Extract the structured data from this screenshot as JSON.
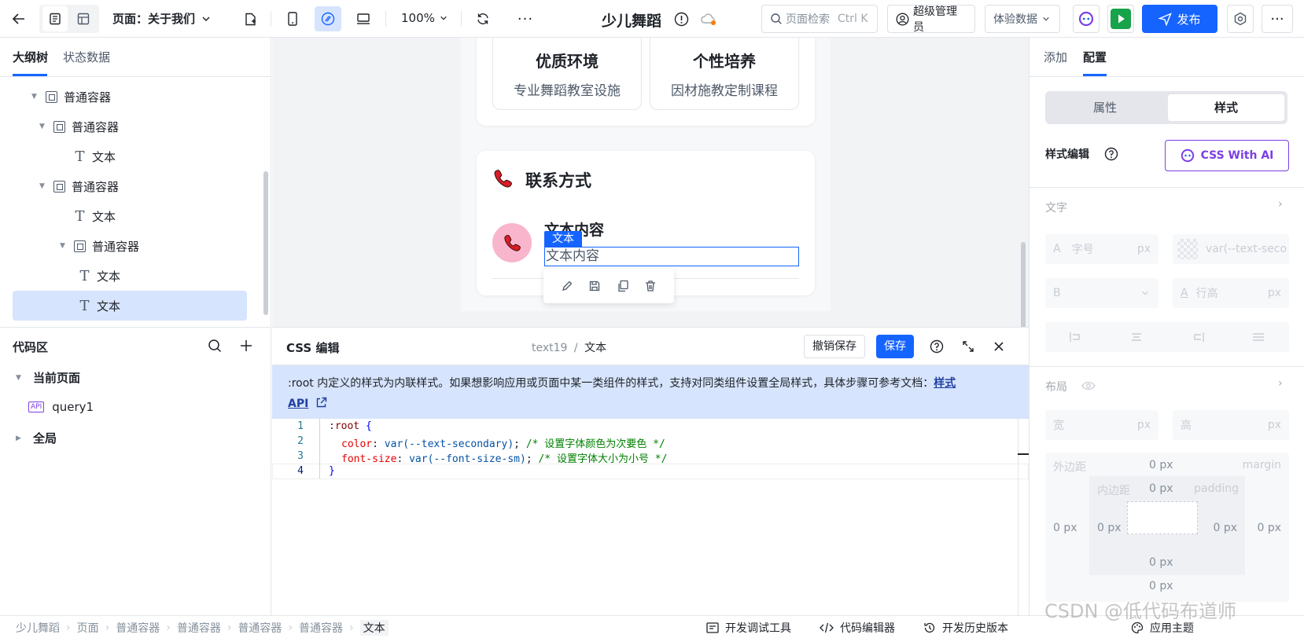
{
  "topbar": {
    "page_label": "页面：关于我们",
    "zoom": "100%",
    "app_title": "少儿舞蹈",
    "search_placeholder": "页面检索",
    "search_shortcut": "Ctrl K",
    "user_role": "超级管理员",
    "data_mode": "体验数据",
    "publish_label": "发布"
  },
  "left": {
    "tabs": [
      "大纲树",
      "状态数据"
    ],
    "tree": [
      {
        "label": "普通容器",
        "type": "container",
        "depth": 0
      },
      {
        "label": "普通容器",
        "type": "container",
        "depth": 1
      },
      {
        "label": "文本",
        "type": "text",
        "depth": 2
      },
      {
        "label": "普通容器",
        "type": "container",
        "depth": 1
      },
      {
        "label": "文本",
        "type": "text",
        "depth": 2
      },
      {
        "label": "普通容器",
        "type": "container",
        "depth": 2
      },
      {
        "label": "文本",
        "type": "text",
        "depth": 3
      },
      {
        "label": "文本",
        "type": "text",
        "depth": 3,
        "selected": true
      }
    ],
    "code_area": {
      "title": "代码区",
      "current_page": "当前页面",
      "query": "query1",
      "query_badge": "API",
      "global": "全局"
    }
  },
  "canvas": {
    "features": [
      {
        "title": "优质环境",
        "subtitle": "专业舞蹈教室设施"
      },
      {
        "title": "个性培养",
        "subtitle": "因材施教定制课程"
      }
    ],
    "contact_title": "联系方式",
    "contact_heading": "文本内容",
    "selection_tag": "文本",
    "selected_text": "文本内容"
  },
  "code": {
    "title": "CSS 编辑",
    "path_id": "text19",
    "path_sep": "/",
    "path_name": "文本",
    "revert_label": "撤销保存",
    "save_label": "保存",
    "notice_text": ":root 内定义的样式为内联样式。如果想影响应用或页面中某一类组件的样式，支持对同类组件设置全局样式，具体步骤可参考文档：",
    "notice_link": "样式",
    "notice_link2": "API",
    "lines": [
      {
        "n": "1",
        "sel": ":root",
        "brace": " {"
      },
      {
        "n": "2",
        "prop": "color",
        "val": "var(--text-secondary)",
        "comment": "/* 设置字体颜色为次要色 */"
      },
      {
        "n": "3",
        "prop": "font-size",
        "val": "var(--font-size-sm)",
        "comment": "/* 设置字体大小为小号 */"
      },
      {
        "n": "4",
        "brace": "}"
      }
    ]
  },
  "right": {
    "tabs": [
      "添加",
      "配置"
    ],
    "segments": [
      "属性",
      "样式"
    ],
    "style_edit": "样式编辑",
    "ai_button": "CSS With AI",
    "text_section": "文字",
    "font_size_ph": "字号",
    "unit_px": "px",
    "color_value": "var(--text-seco",
    "line_height_ph": "行高",
    "layout_section": "布局",
    "width_ph": "宽",
    "height_ph": "高",
    "margin_label": "外边距",
    "margin_en": "margin",
    "padding_label": "内边距",
    "padding_en": "padding",
    "zero_px": "0 px",
    "letter_a": "A",
    "letter_b": "B"
  },
  "bottom": {
    "breadcrumb": [
      "少儿舞蹈",
      "页面",
      "普通容器",
      "普通容器",
      "普通容器",
      "普通容器",
      "文本"
    ],
    "dev_tools": "开发调试工具",
    "code_editor": "代码编辑器",
    "history": "开发历史版本",
    "theme": "应用主题",
    "watermark": "CSDN @低代码布道师"
  },
  "colors": {
    "primary": "#1664ff",
    "selection": "#d6e4fd",
    "green": "#16a34a",
    "purple": "#7b3fe4"
  }
}
